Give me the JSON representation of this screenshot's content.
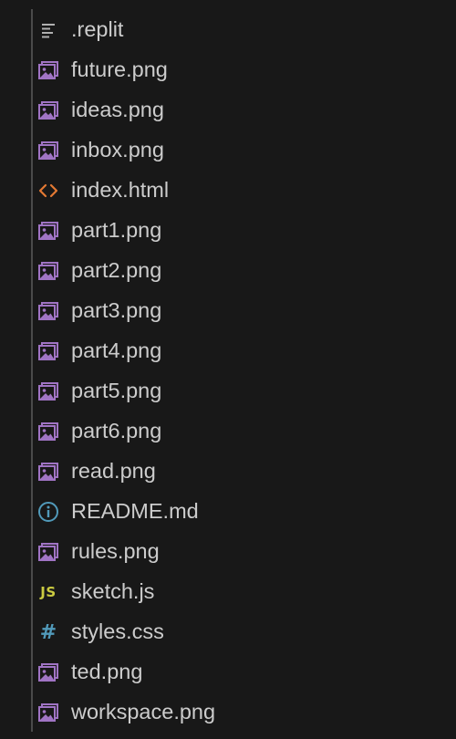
{
  "explorer": {
    "files": [
      {
        "name": ".replit",
        "icon": "lines-icon"
      },
      {
        "name": "future.png",
        "icon": "image-icon"
      },
      {
        "name": "ideas.png",
        "icon": "image-icon"
      },
      {
        "name": "inbox.png",
        "icon": "image-icon"
      },
      {
        "name": "index.html",
        "icon": "code-brackets-icon"
      },
      {
        "name": "part1.png",
        "icon": "image-icon"
      },
      {
        "name": "part2.png",
        "icon": "image-icon"
      },
      {
        "name": "part3.png",
        "icon": "image-icon"
      },
      {
        "name": "part4.png",
        "icon": "image-icon"
      },
      {
        "name": "part5.png",
        "icon": "image-icon"
      },
      {
        "name": "part6.png",
        "icon": "image-icon"
      },
      {
        "name": "read.png",
        "icon": "image-icon"
      },
      {
        "name": "README.md",
        "icon": "info-icon"
      },
      {
        "name": "rules.png",
        "icon": "image-icon"
      },
      {
        "name": "sketch.js",
        "icon": "js-icon"
      },
      {
        "name": "styles.css",
        "icon": "hash-icon"
      },
      {
        "name": "ted.png",
        "icon": "image-icon"
      },
      {
        "name": "workspace.png",
        "icon": "image-icon"
      }
    ]
  },
  "colors": {
    "background": "#181818",
    "text": "#cccccc",
    "image_icon": "#a074c4",
    "html_icon": "#e37933",
    "info_icon": "#519aba",
    "js_icon": "#cbcb41",
    "css_icon": "#519aba",
    "generic_icon": "#b0b0b0",
    "indent_guide": "#4a4a4a"
  }
}
